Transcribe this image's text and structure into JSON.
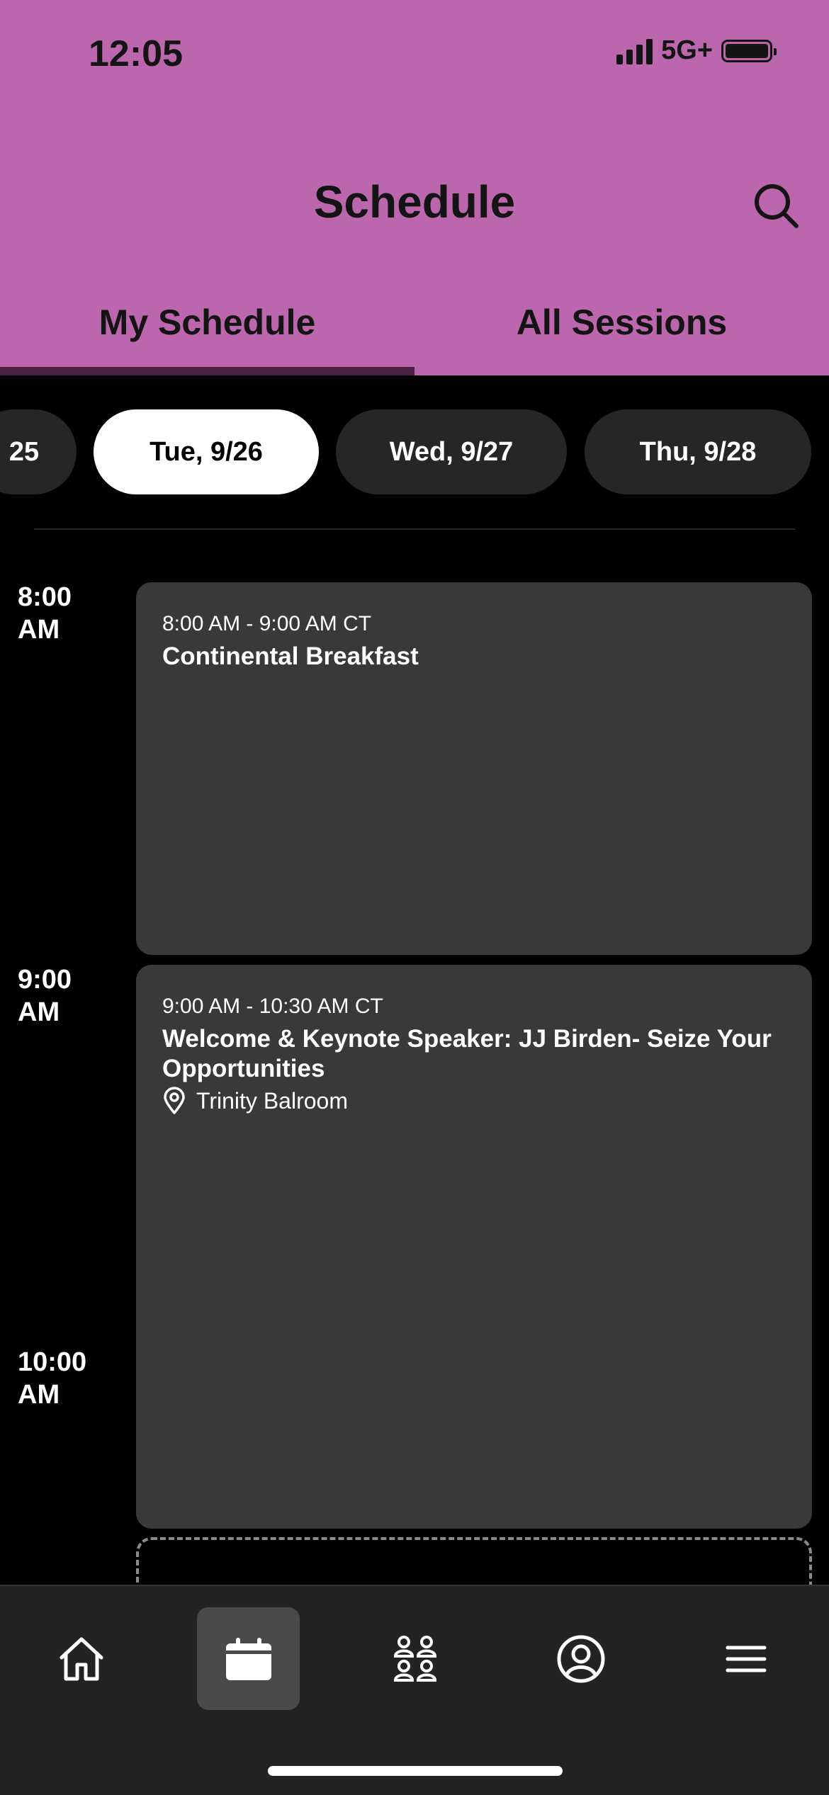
{
  "status_bar": {
    "time": "12:05",
    "network": "5G+"
  },
  "header": {
    "title": "Schedule",
    "tabs": [
      {
        "label": "My Schedule",
        "active": true
      },
      {
        "label": "All Sessions",
        "active": false
      }
    ]
  },
  "dates": [
    {
      "label": "25",
      "selected": false
    },
    {
      "label": "Tue, 9/26",
      "selected": true
    },
    {
      "label": "Wed, 9/27",
      "selected": false
    },
    {
      "label": "Thu, 9/28",
      "selected": false
    }
  ],
  "timeline": {
    "hours": [
      "8:00\nAM",
      "9:00\nAM",
      "10:00\nAM"
    ]
  },
  "events": [
    {
      "time": "8:00 AM - 9:00 AM CT",
      "title": "Continental Breakfast"
    },
    {
      "time": "9:00 AM - 10:30 AM CT",
      "title": "Welcome & Keynote Speaker: JJ Birden- Seize Your Opportunities",
      "location": "Trinity Balroom"
    }
  ],
  "bottom_nav": [
    {
      "icon": "home-icon",
      "active": false
    },
    {
      "icon": "calendar-icon",
      "active": true
    },
    {
      "icon": "people-icon",
      "active": false
    },
    {
      "icon": "profile-icon",
      "active": false
    },
    {
      "icon": "menu-icon",
      "active": false
    }
  ],
  "colors": {
    "header": "#BC67AD",
    "tab_indicator": "#4A2143",
    "card": "#393939",
    "nav": "#232323"
  }
}
